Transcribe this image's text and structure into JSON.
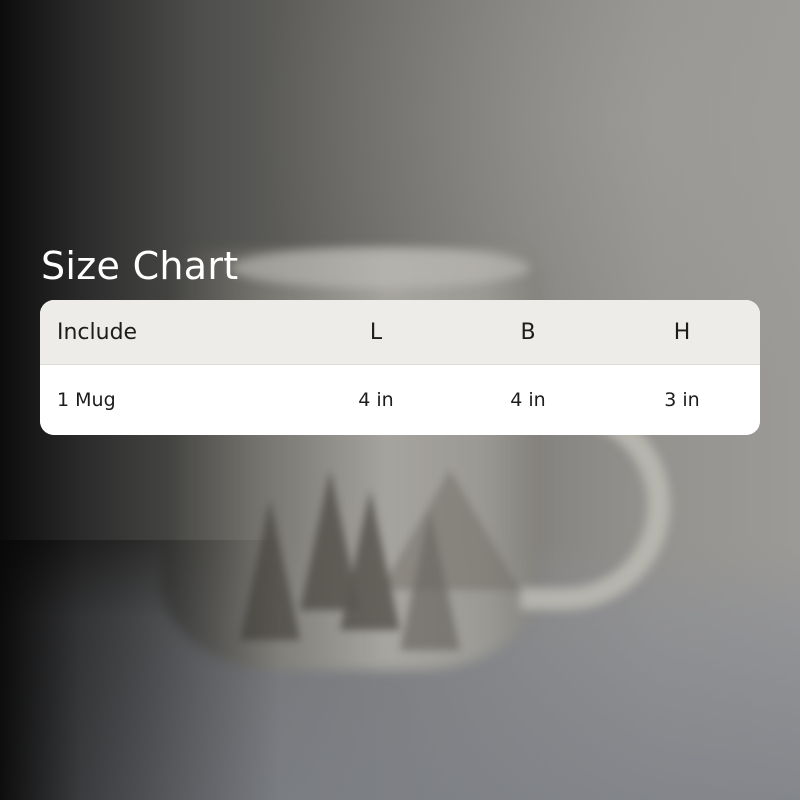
{
  "title": "Size Chart",
  "table": {
    "headers": [
      "Include",
      "L",
      "B",
      "H"
    ],
    "rows": [
      [
        "1 Mug",
        "4 in",
        "4 in",
        "3 in"
      ]
    ]
  }
}
